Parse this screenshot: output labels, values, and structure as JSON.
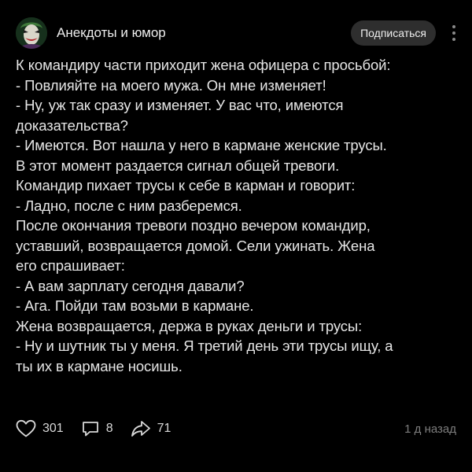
{
  "header": {
    "channel_name": "Анекдоты и юмор",
    "subscribe_label": "Подписаться",
    "avatar_icon": "joker-avatar",
    "more_icon": "vertical-dots-icon"
  },
  "post": {
    "lines": [
      "К командиру части приходит жена офицера с просьбой:",
      "- Повлияйте на моего мужа. Он мне изменяет!",
      "- Ну, уж так сразу и изменяет. У вас что, имеются",
      "доказательства?",
      "- Имеются. Вот нашла у него в кармане женские трусы.",
      "В этот момент раздается сигнал общей тревоги.",
      "Командир пихает трусы к себе в карман и говорит:",
      "- Ладно, после с ним разберемся.",
      "После окончания тревоги поздно вечером командир,",
      "уставший, возвращается домой. Сели ужинать. Жена",
      "его спрашивает:",
      "- А вам зарплату сегодня давали?",
      "- Ага. Пойди там возьми в кармане.",
      "Жена возвращается, держа в руках деньги и трусы:",
      "- Ну и шутник ты у меня. Я третий день эти трусы ищу, а",
      "ты их в кармане носишь."
    ]
  },
  "footer": {
    "likes": "301",
    "comments": "8",
    "shares": "71",
    "timestamp": "1 д назад",
    "like_icon": "heart-icon",
    "comment_icon": "comment-icon",
    "share_icon": "share-icon"
  },
  "colors": {
    "background": "#000000",
    "text": "#e6e6e6",
    "muted": "#7d7d7d",
    "button_bg": "#2e2e2e"
  }
}
